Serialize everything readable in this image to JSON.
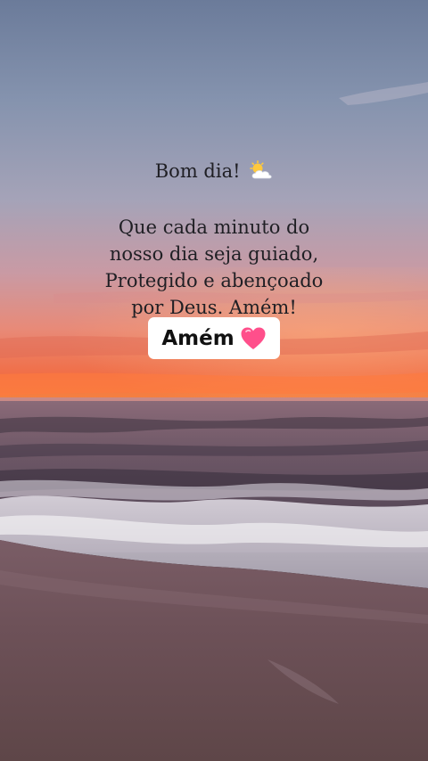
{
  "post": {
    "greeting": "Bom dia!",
    "greeting_icon": "sun-behind-cloud-icon",
    "message_lines": [
      "Que cada minuto do",
      "nosso dia seja guiado,",
      "Protegido e abençoado",
      "por Deus. Amém!"
    ],
    "badge": {
      "label": "Amém",
      "icon": "pink-heart-icon",
      "heart_color": "#ff4f8b"
    }
  },
  "colors": {
    "text": "#1f1f24",
    "sky_top": "#6f7f9e",
    "horizon_glow": "#f26a3c",
    "sea": "#5c4f5e",
    "sand": "#6b5050"
  }
}
